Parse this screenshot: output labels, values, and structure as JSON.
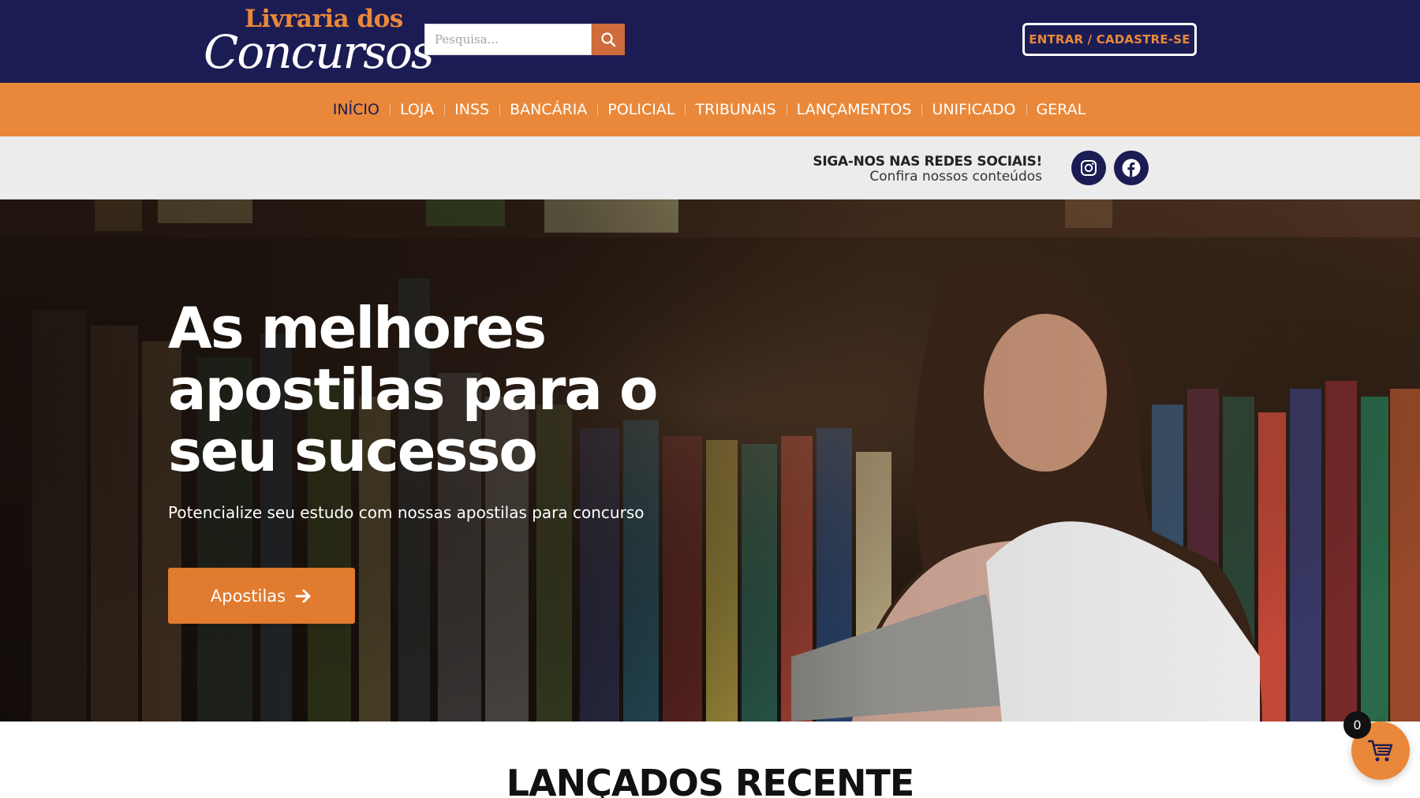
{
  "header": {
    "logo": {
      "line1": "Livraria dos",
      "line2": "Concursos"
    },
    "search": {
      "placeholder": "Pesquisa...",
      "value": "",
      "button_icon": "search-icon"
    },
    "login_label": "ENTRAR / CADASTRE-SE"
  },
  "nav": {
    "items": [
      {
        "label": "INÍCIO",
        "active": true
      },
      {
        "label": "LOJA",
        "active": false
      },
      {
        "label": "INSS",
        "active": false
      },
      {
        "label": "BANCÁRIA",
        "active": false
      },
      {
        "label": "POLICIAL",
        "active": false
      },
      {
        "label": "TRIBUNAIS",
        "active": false
      },
      {
        "label": "LANÇAMENTOS",
        "active": false
      },
      {
        "label": "UNIFICADO",
        "active": false
      },
      {
        "label": "GERAL",
        "active": false
      }
    ]
  },
  "social": {
    "title": "SIGA-NOS NAS REDES SOCIAIS!",
    "subtitle": "Confira nossos conteúdos",
    "icons": [
      "instagram-icon",
      "facebook-icon"
    ]
  },
  "hero": {
    "title_lines": [
      "As melhores",
      "apostilas para o",
      "seu sucesso"
    ],
    "subtitle": "Potencialize seu estudo com nossas apostilas para concurso",
    "button_label": "Apostilas",
    "button_icon": "arrow-right-icon"
  },
  "section": {
    "title": "LANÇADOS RECENTE"
  },
  "cart": {
    "count": "0",
    "icon": "cart-icon"
  },
  "colors": {
    "header_bg": "#1c1c54",
    "accent": "#e9883a",
    "search_button": "#d06b3c",
    "social_strip_bg": "#ececec"
  }
}
